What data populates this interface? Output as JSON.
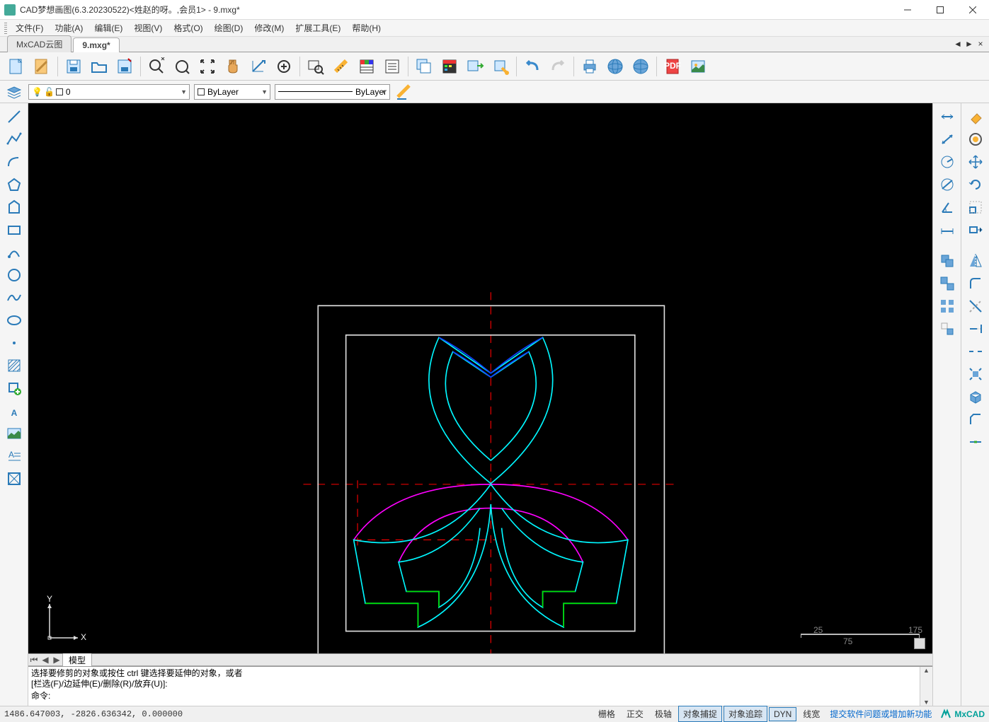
{
  "title": "CAD梦想画图(6.3.20230522)<姓赵的呀。,会员1> - 9.mxg*",
  "menus": [
    "文件(F)",
    "功能(A)",
    "编辑(E)",
    "视图(V)",
    "格式(O)",
    "绘图(D)",
    "修改(M)",
    "扩展工具(E)",
    "帮助(H)"
  ],
  "tabs": [
    {
      "label": "MxCAD云图",
      "active": false
    },
    {
      "label": "9.mxg*",
      "active": true
    }
  ],
  "layer_combo": {
    "value": "0",
    "icons": "lightbulb-lock-color"
  },
  "color_combo": {
    "value": "ByLayer"
  },
  "linetype_combo": {
    "value": "ByLayer"
  },
  "model_tab": "模型",
  "command_history": [
    "选择要修剪的对象或按住 ctrl 键选择要延伸的对象，或者",
    "[栏选(F)/边延伸(E)/删除(R)/放弃(U)]:"
  ],
  "command_prompt": "命令: ",
  "status": {
    "coords": "1486.647003,  -2826.636342,  0.000000",
    "buttons": [
      {
        "label": "栅格",
        "active": false
      },
      {
        "label": "正交",
        "active": false
      },
      {
        "label": "极轴",
        "active": false
      },
      {
        "label": "对象捕捉",
        "active": true
      },
      {
        "label": "对象追踪",
        "active": true
      },
      {
        "label": "DYN",
        "active": true
      },
      {
        "label": "线宽",
        "active": false
      }
    ],
    "link": "提交软件问题或增加新功能",
    "brand": "MxCAD"
  },
  "scale": {
    "left": "25",
    "mid": "75",
    "right": "175"
  },
  "ucs": {
    "x": "X",
    "y": "Y"
  }
}
